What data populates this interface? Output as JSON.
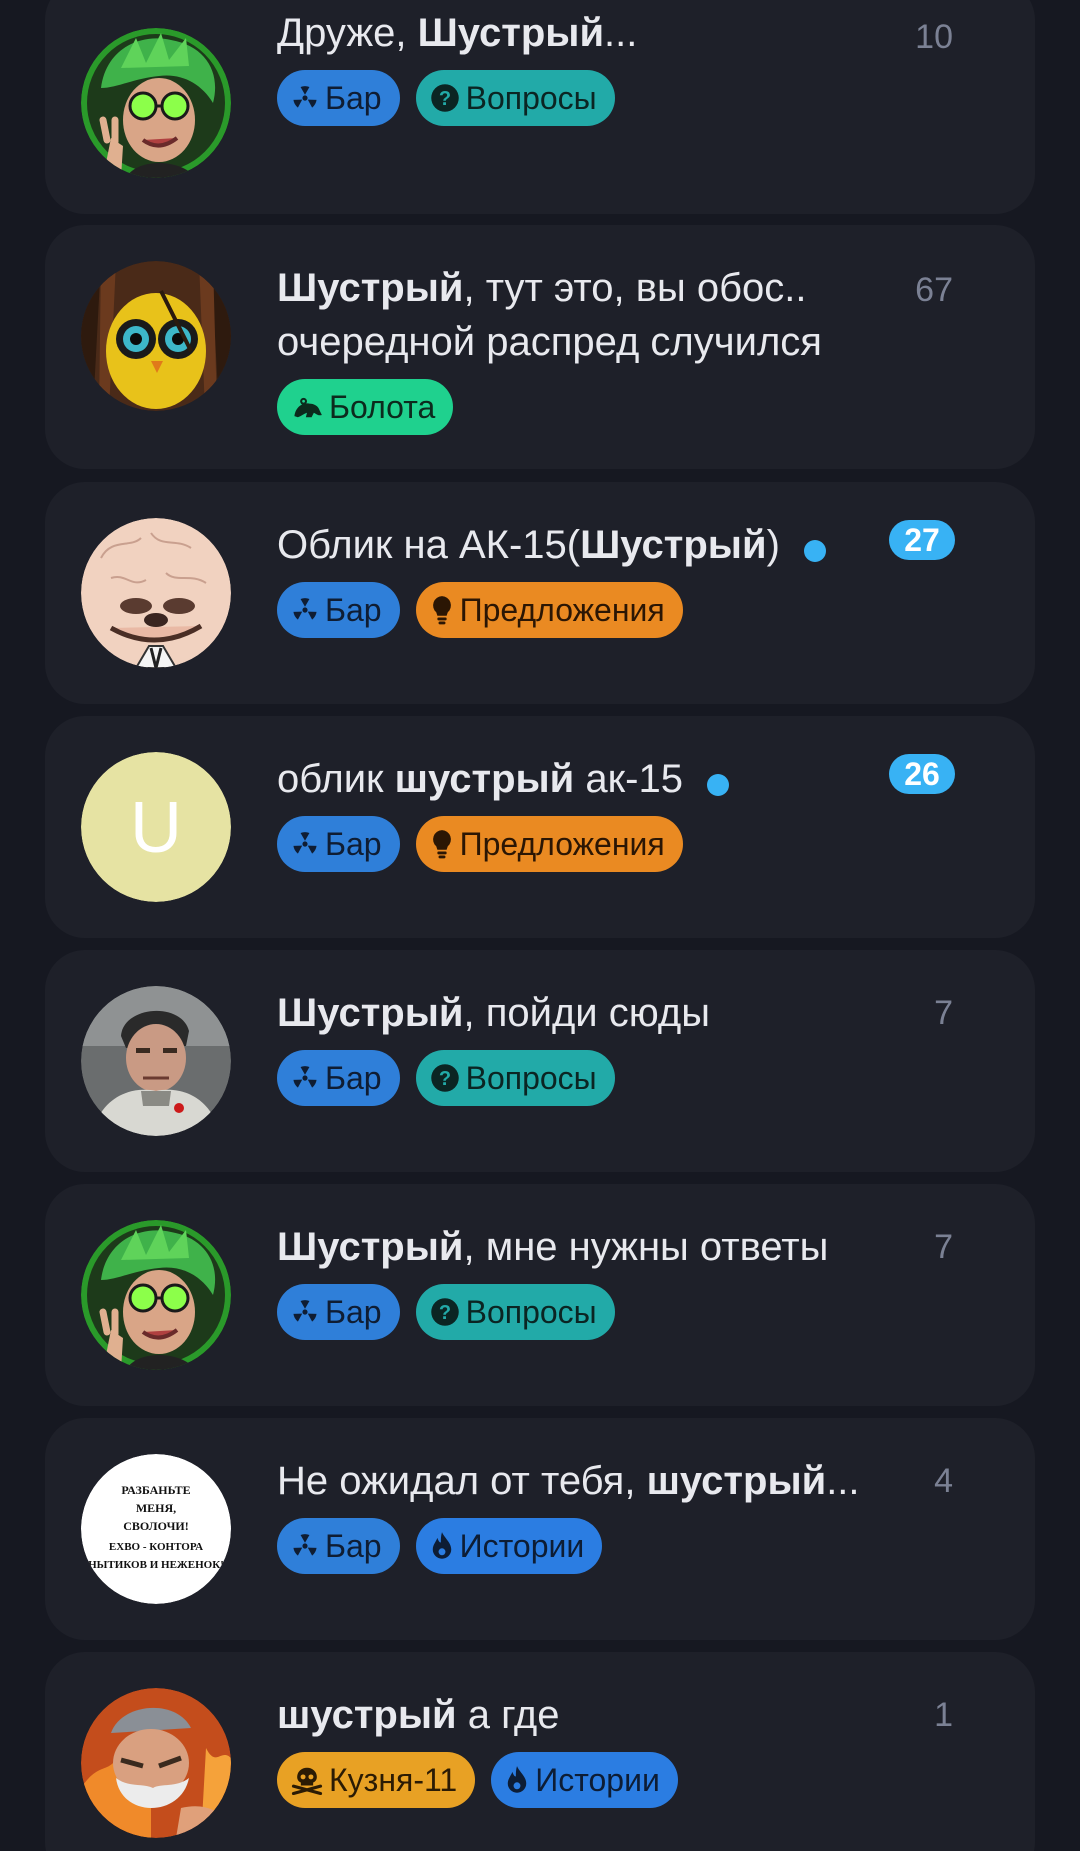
{
  "threads": [
    {
      "title_parts": [
        {
          "t": "Друже, ",
          "b": false
        },
        {
          "t": "Шустрый",
          "b": true
        },
        {
          "t": "...",
          "b": false
        }
      ],
      "count": "10",
      "count_badge": false,
      "unread_dot": false,
      "avatar": "avatar-green-hair",
      "tags": [
        {
          "label": "Бар",
          "icon": "radiation-icon",
          "style": "bar"
        },
        {
          "label": "Вопросы",
          "icon": "question-icon",
          "style": "q"
        }
      ]
    },
    {
      "title_parts": [
        {
          "t": "Шустрый",
          "b": true
        },
        {
          "t": ", тут это, вы обос..",
          "b": false
        }
      ],
      "title_line2": "очередной распред случился",
      "count": "67",
      "count_badge": false,
      "unread_dot": false,
      "avatar": "avatar-yellow-owl",
      "tags": [
        {
          "label": "Болота",
          "icon": "frog-icon",
          "style": "swamp"
        }
      ]
    },
    {
      "title_parts": [
        {
          "t": "Облик на АК-15(",
          "b": false
        },
        {
          "t": "Шустрый",
          "b": true
        },
        {
          "t": ")",
          "b": false
        }
      ],
      "count": "27",
      "count_badge": true,
      "unread_dot": true,
      "avatar": "avatar-brain-face",
      "tags": [
        {
          "label": "Бар",
          "icon": "radiation-icon",
          "style": "bar"
        },
        {
          "label": "Предложения",
          "icon": "lightbulb-icon",
          "style": "idea"
        }
      ]
    },
    {
      "title_parts": [
        {
          "t": "облик ",
          "b": false
        },
        {
          "t": "шустрый",
          "b": true
        },
        {
          "t": " ак-15",
          "b": false
        }
      ],
      "count": "26",
      "count_badge": true,
      "unread_dot": true,
      "avatar": "avatar-letter-u",
      "avatar_letter": "U",
      "tags": [
        {
          "label": "Бар",
          "icon": "radiation-icon",
          "style": "bar"
        },
        {
          "label": "Предложения",
          "icon": "lightbulb-icon",
          "style": "idea"
        }
      ]
    },
    {
      "title_parts": [
        {
          "t": "Шустрый",
          "b": true
        },
        {
          "t": ", пойди сюды",
          "b": false
        }
      ],
      "count": "7",
      "count_badge": false,
      "unread_dot": false,
      "avatar": "avatar-soldier",
      "tags": [
        {
          "label": "Бар",
          "icon": "radiation-icon",
          "style": "bar"
        },
        {
          "label": "Вопросы",
          "icon": "question-icon",
          "style": "q"
        }
      ]
    },
    {
      "title_parts": [
        {
          "t": "Шустрый",
          "b": true
        },
        {
          "t": ", мне нужны ответы",
          "b": false
        }
      ],
      "count": "7",
      "count_badge": false,
      "unread_dot": false,
      "avatar": "avatar-green-hair",
      "tags": [
        {
          "label": "Бар",
          "icon": "radiation-icon",
          "style": "bar"
        },
        {
          "label": "Вопросы",
          "icon": "question-icon",
          "style": "q"
        }
      ]
    },
    {
      "title_parts": [
        {
          "t": "Не ожидал от тебя, ",
          "b": false
        },
        {
          "t": "шустрый",
          "b": true
        },
        {
          "t": "...",
          "b": false
        }
      ],
      "count": "4",
      "count_badge": false,
      "unread_dot": false,
      "avatar": "avatar-text-sign",
      "avatar_text": [
        "РАЗБАНЬТЕ",
        "МЕНЯ,",
        "СВОЛОЧИ!",
        "EXBO - КОНТОРА",
        "НЫТИКОВ И НЕЖЕНОК!"
      ],
      "tags": [
        {
          "label": "Бар",
          "icon": "radiation-icon",
          "style": "bar"
        },
        {
          "label": "Истории",
          "icon": "flame-icon",
          "style": "story"
        }
      ]
    },
    {
      "title_parts": [
        {
          "t": "шустрый",
          "b": true
        },
        {
          "t": " а где",
          "b": false
        }
      ],
      "count": "1",
      "count_badge": false,
      "unread_dot": false,
      "avatar": "avatar-bearded-man",
      "tags": [
        {
          "label": "Кузня-11",
          "icon": "skull-icon",
          "style": "forge"
        },
        {
          "label": "Истории",
          "icon": "flame-icon",
          "style": "story"
        }
      ]
    }
  ],
  "colors": {
    "background": "#161821",
    "card": "#1e2029",
    "accent_blue": "#38b2f4",
    "tag_bar": "#2f7fd9",
    "tag_questions": "#22aaa8",
    "tag_swamp": "#1fd18e",
    "tag_ideas": "#ea8a22",
    "tag_stories": "#2b7de2",
    "tag_forge": "#e8a124"
  }
}
